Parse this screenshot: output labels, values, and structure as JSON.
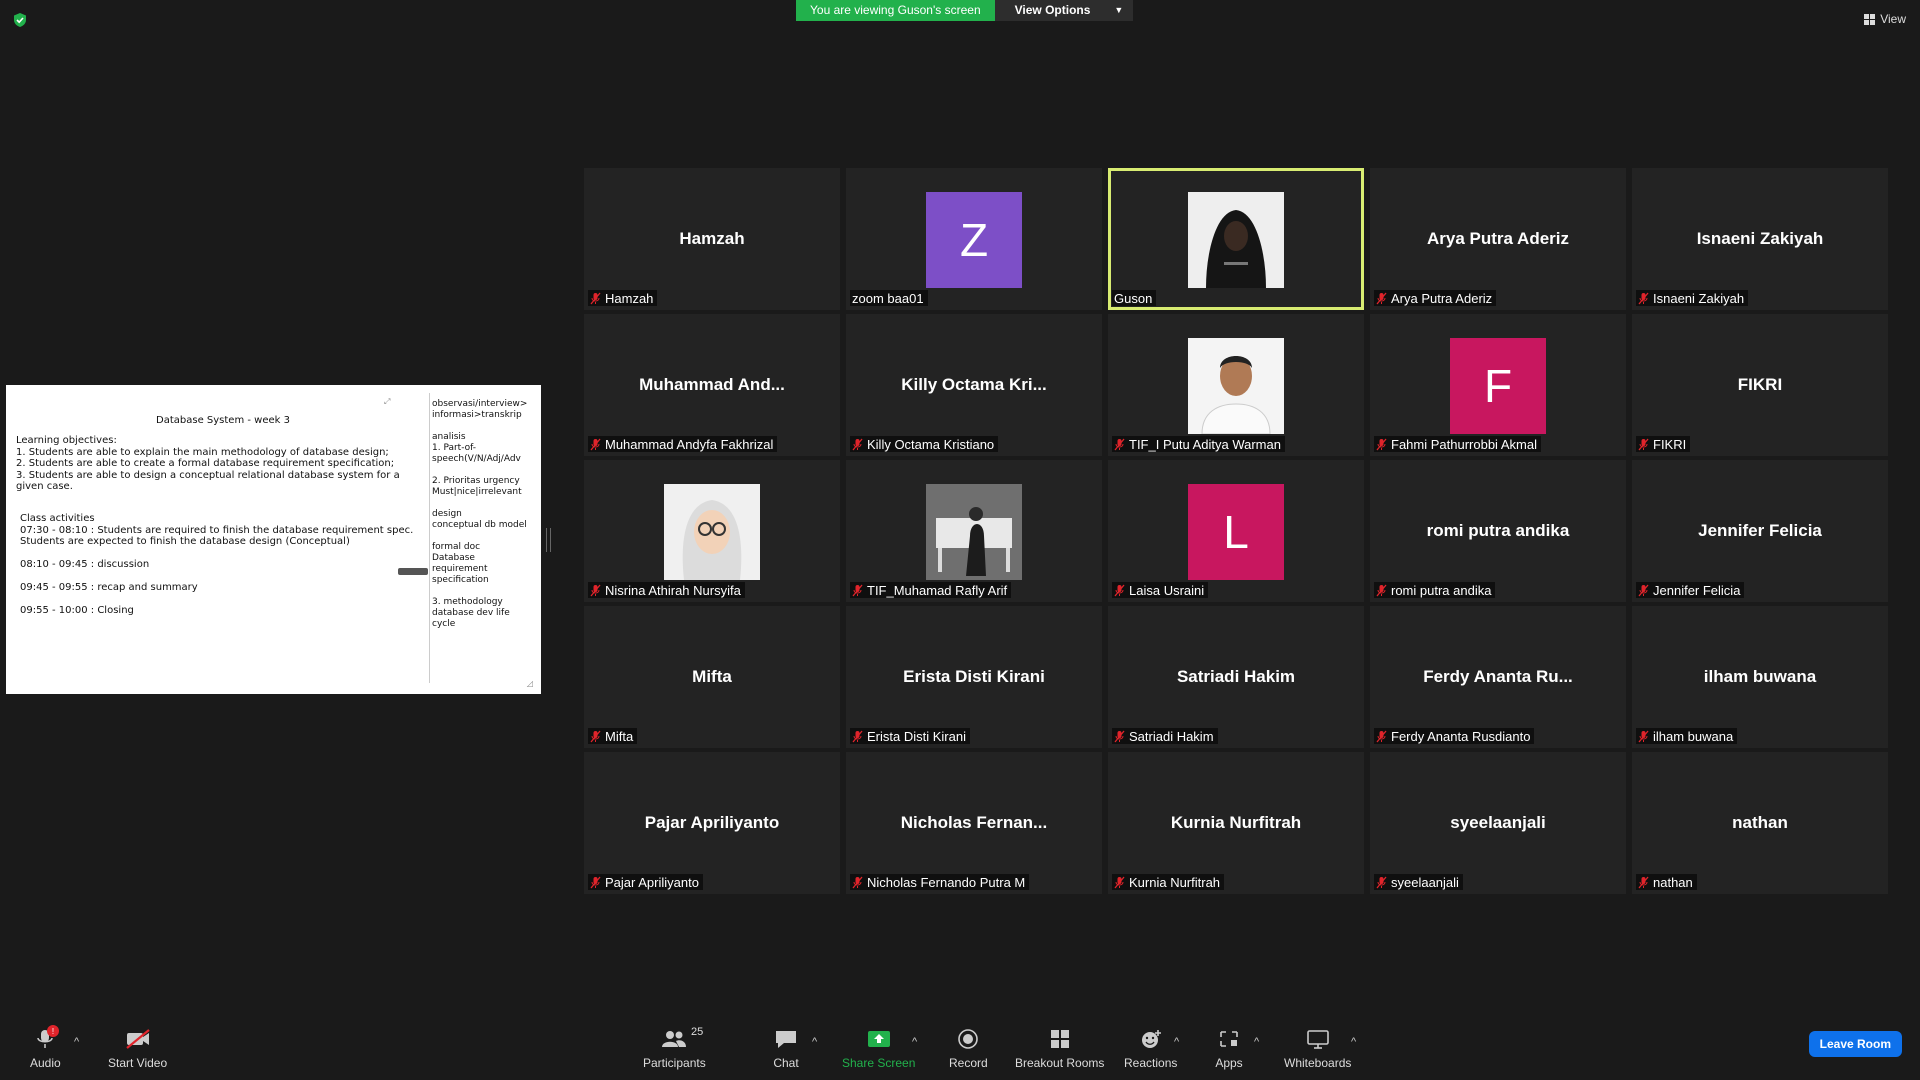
{
  "top": {
    "viewing_banner": "You are viewing Guson's screen",
    "view_options": "View Options",
    "view_button": "View"
  },
  "shared_doc": {
    "title": "Database System - week 3",
    "objectives": "Learning objectives:\n1. Students are able to explain the main methodology of database design;\n2. Students are able to create a formal database requirement specification;\n3. Students are able to design a conceptual relational database system for a given case.",
    "activities": "Class activities\n 07:30 - 08:10 : Students are required to finish the database requirement spec.\n                       Students are expected to finish the database design (Conceptual)\n\n 08:10 - 09:45 : discussion\n\n 09:45 - 09:55 : recap and summary\n\n 09:55 - 10:00 : Closing",
    "side_notes": "observasi/interview>\ninformasi>transkrip\n\nanalisis\n1. Part-of-\nspeech(V/N/Adj/Adv\n\n2. Prioritas urgency\nMust|nice|irrelevant\n\ndesign\nconceptual db model\n\nformal doc\nDatabase\nrequirement\nspecification\n\n 3. methodology\n database dev life\n cycle"
  },
  "participants": [
    {
      "display": "Hamzah",
      "name": "Hamzah",
      "type": "name",
      "muted": true
    },
    {
      "display": "Z",
      "name": "zoom baa01",
      "type": "avatar",
      "color": "#7d4fc7",
      "muted": false
    },
    {
      "display": "",
      "name": "Guson",
      "type": "photo",
      "photo": "hoodie",
      "muted": false,
      "active": true
    },
    {
      "display": "Arya Putra Aderiz",
      "name": "Arya Putra Aderiz",
      "type": "name",
      "muted": true
    },
    {
      "display": "Isnaeni Zakiyah",
      "name": "Isnaeni Zakiyah",
      "type": "name",
      "muted": true
    },
    {
      "display": "Muhammad  And...",
      "name": "Muhammad Andyfa Fakhrizal",
      "type": "name",
      "muted": true
    },
    {
      "display": "Killy  Octama  Kri...",
      "name": "Killy Octama Kristiano",
      "type": "name",
      "muted": true
    },
    {
      "display": "",
      "name": "TIF_I Putu Aditya Warman",
      "type": "photo",
      "photo": "portrait",
      "muted": true
    },
    {
      "display": "F",
      "name": "Fahmi Pathurrobbi Akmal",
      "type": "avatar",
      "color": "#c8175f",
      "muted": true
    },
    {
      "display": "FIKRI",
      "name": "FIKRI",
      "type": "name",
      "muted": true
    },
    {
      "display": "",
      "name": "Nisrina Athirah Nursyifa",
      "type": "photo",
      "photo": "memoji",
      "muted": true
    },
    {
      "display": "",
      "name": "TIF_Muhamad Rafly Arif",
      "type": "photo",
      "photo": "bench",
      "muted": true
    },
    {
      "display": "L",
      "name": "Laisa Usraini",
      "type": "avatar",
      "color": "#c8175f",
      "muted": true
    },
    {
      "display": "romi putra andika",
      "name": "romi putra andika",
      "type": "name",
      "muted": true
    },
    {
      "display": "Jennifer Felicia",
      "name": "Jennifer Felicia",
      "type": "name",
      "muted": true
    },
    {
      "display": "Mifta",
      "name": "Mifta",
      "type": "name",
      "muted": true
    },
    {
      "display": "Erista Disti Kirani",
      "name": "Erista Disti Kirani",
      "type": "name",
      "muted": true
    },
    {
      "display": "Satriadi Hakim",
      "name": "Satriadi Hakim",
      "type": "name",
      "muted": true
    },
    {
      "display": "Ferdy  Ananta  Ru...",
      "name": "Ferdy Ananta Rusdianto",
      "type": "name",
      "muted": true
    },
    {
      "display": "ilham buwana",
      "name": "ilham buwana",
      "type": "name",
      "muted": true
    },
    {
      "display": "Pajar Apriliyanto",
      "name": "Pajar Apriliyanto",
      "type": "name",
      "muted": true
    },
    {
      "display": "Nicholas  Fernan...",
      "name": "Nicholas Fernando Putra M",
      "type": "name",
      "muted": true
    },
    {
      "display": "Kurnia Nurfitrah",
      "name": "Kurnia Nurfitrah",
      "type": "name",
      "muted": true
    },
    {
      "display": "syeelaanjali",
      "name": "syeelaanjali",
      "type": "name",
      "muted": true
    },
    {
      "display": "nathan",
      "name": "nathan",
      "type": "name",
      "muted": true
    }
  ],
  "toolbar": {
    "audio": "Audio",
    "audio_badge": "!",
    "start_video": "Start Video",
    "participants": "Participants",
    "participants_count": "25",
    "chat": "Chat",
    "share_screen": "Share Screen",
    "record": "Record",
    "breakout_rooms": "Breakout Rooms",
    "reactions": "Reactions",
    "apps": "Apps",
    "whiteboards": "Whiteboards",
    "leave": "Leave Room"
  },
  "colors": {
    "accent_green": "#22b14c",
    "active_speaker": "#d8ec72",
    "leave_blue": "#0e71eb",
    "mute_red": "#e0242b"
  }
}
